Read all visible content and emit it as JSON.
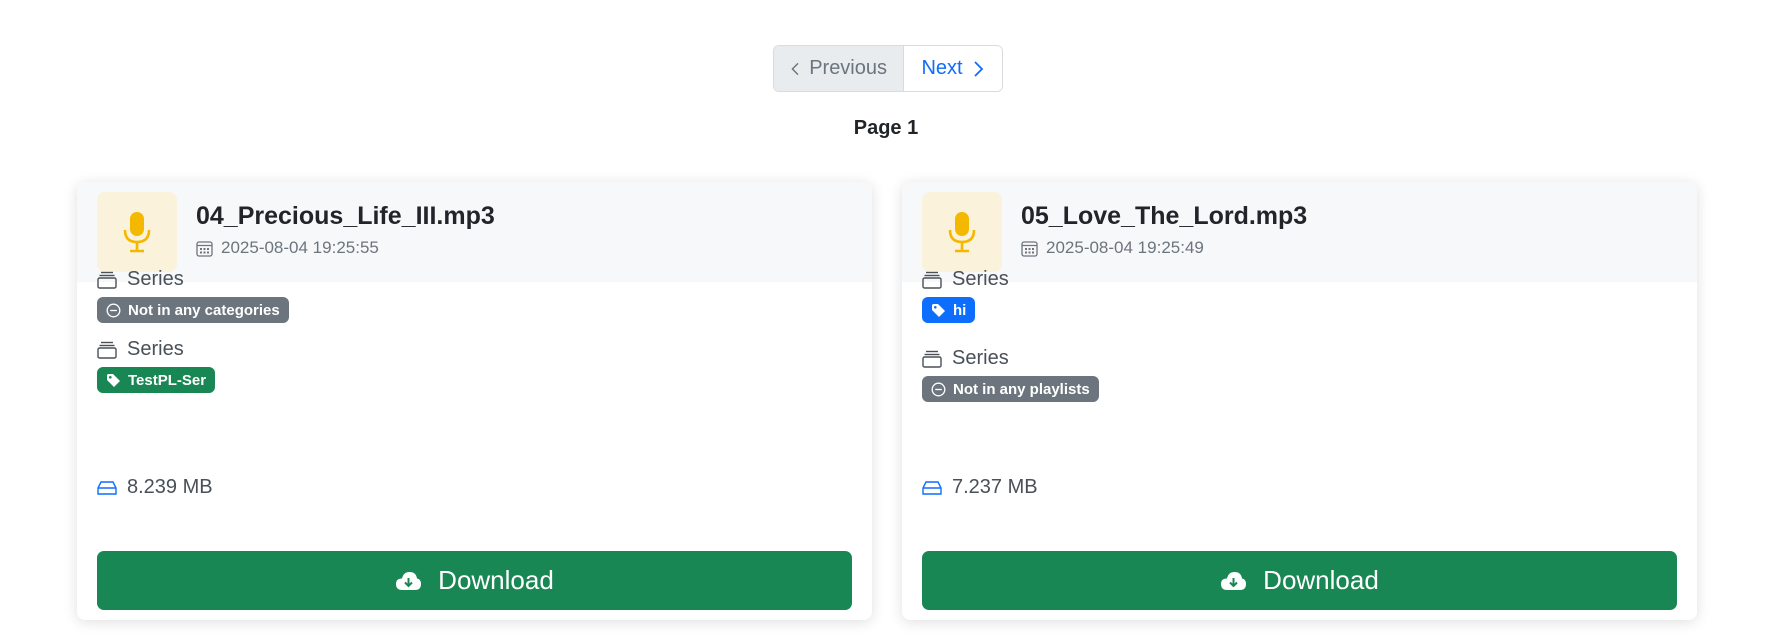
{
  "pagination": {
    "previous_label": "Previous",
    "next_label": "Next",
    "page_label": "Page 1"
  },
  "cards": [
    {
      "file_name": "04_Precious_Life_III.mp3",
      "date": "2025-08-04 19:25:55",
      "section1_title": "Series",
      "section1_badge": "Not in any categories",
      "section2_title": "Series",
      "section2_badge": "TestPL-Ser",
      "size": "8.239 MB",
      "download_label": "Download"
    },
    {
      "file_name": "05_Love_The_Lord.mp3",
      "date": "2025-08-04 19:25:49",
      "section1_title": "Series",
      "section1_badge": "hi",
      "section2_title": "Series",
      "section2_badge": "Not in any playlists",
      "size": "7.237 MB",
      "download_label": "Download"
    }
  ],
  "colors": {
    "accent_blue": "#0d6efd",
    "success_green": "#198754",
    "muted_gray": "#6c757d",
    "mic_yellow": "#f5b800"
  },
  "icons": [
    "chevron-left-icon",
    "chevron-right-icon",
    "microphone-icon",
    "calendar-icon",
    "collection-icon",
    "dash-circle-icon",
    "tag-icon",
    "drive-icon",
    "cloud-download-icon"
  ]
}
